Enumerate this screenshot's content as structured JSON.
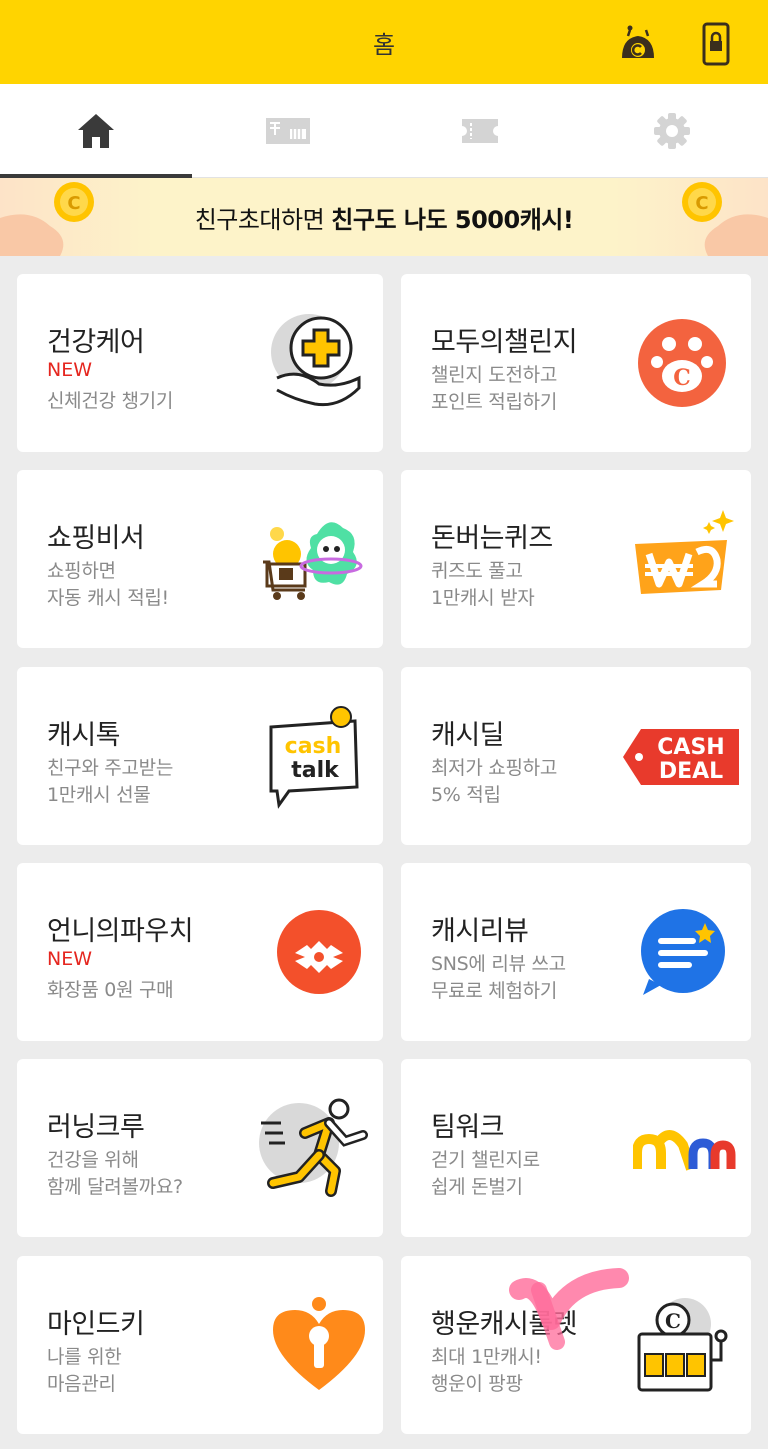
{
  "header": {
    "title": "홈",
    "cash_icon": "cash-character-icon",
    "lock_icon": "lock-phone-icon",
    "color": "#ffd400"
  },
  "tabs": [
    {
      "icon": "home-icon",
      "active": true
    },
    {
      "icon": "coupon-icon",
      "active": false
    },
    {
      "icon": "ticket-icon",
      "active": false
    },
    {
      "icon": "gear-icon",
      "active": false
    }
  ],
  "banner": {
    "text_normal": "친구초대하면 ",
    "text_bold": "친구도 나도 5000캐시!"
  },
  "cards": [
    {
      "title": "건강케어",
      "new": "NEW",
      "sub1": "신체건강 챙기기",
      "sub2": "",
      "icon": "health-care-hand-plus-icon"
    },
    {
      "title": "모두의챌린지",
      "new": "",
      "sub1": "챌린지 도전하고",
      "sub2": "포인트 적립하기",
      "icon": "challenge-paw-icon"
    },
    {
      "title": "쇼핑비서",
      "new": "",
      "sub1": "쇼핑하면",
      "sub2": "자동 캐시 적립!",
      "icon": "shopping-cart-character-icon"
    },
    {
      "title": "돈버는퀴즈",
      "new": "",
      "sub1": "퀴즈도 풀고",
      "sub2": "1만캐시 받자",
      "icon": "quiz-won-icon"
    },
    {
      "title": "캐시톡",
      "new": "",
      "sub1": "친구와 주고받는",
      "sub2": "1만캐시 선물",
      "icon": "cash-talk-bubble-icon"
    },
    {
      "title": "캐시딜",
      "new": "",
      "sub1": "최저가 쇼핑하고",
      "sub2": "5% 적립",
      "icon": "cash-deal-tag-icon"
    },
    {
      "title": "언니의파우치",
      "new": "NEW",
      "sub1": "화장품 0원 구매",
      "sub2": "",
      "icon": "pouch-circle-icon"
    },
    {
      "title": "캐시리뷰",
      "new": "",
      "sub1": "SNS에 리뷰 쓰고",
      "sub2": "무료로 체험하기",
      "icon": "review-chat-star-icon"
    },
    {
      "title": "러닝크루",
      "new": "",
      "sub1": "건강을 위해",
      "sub2": "함께 달려볼까요?",
      "icon": "runner-icon"
    },
    {
      "title": "팀워크",
      "new": "",
      "sub1": "걷기 챌린지로",
      "sub2": "쉽게 돈벌기",
      "icon": "teamwork-arches-icon"
    },
    {
      "title": "마인드키",
      "new": "",
      "sub1": "나를 위한",
      "sub2": "마음관리",
      "icon": "mind-key-heart-icon"
    },
    {
      "title": "행운캐시룰렛",
      "new": "",
      "sub1": "최대 1만캐시!",
      "sub2": "행운이 팡팡",
      "icon": "slot-machine-icon"
    }
  ],
  "text": {
    "cash_badge": "C",
    "cash_talk_1": "cash",
    "cash_talk_2": "talk",
    "cash_deal_1": "CASH",
    "cash_deal_2": "DEAL"
  }
}
